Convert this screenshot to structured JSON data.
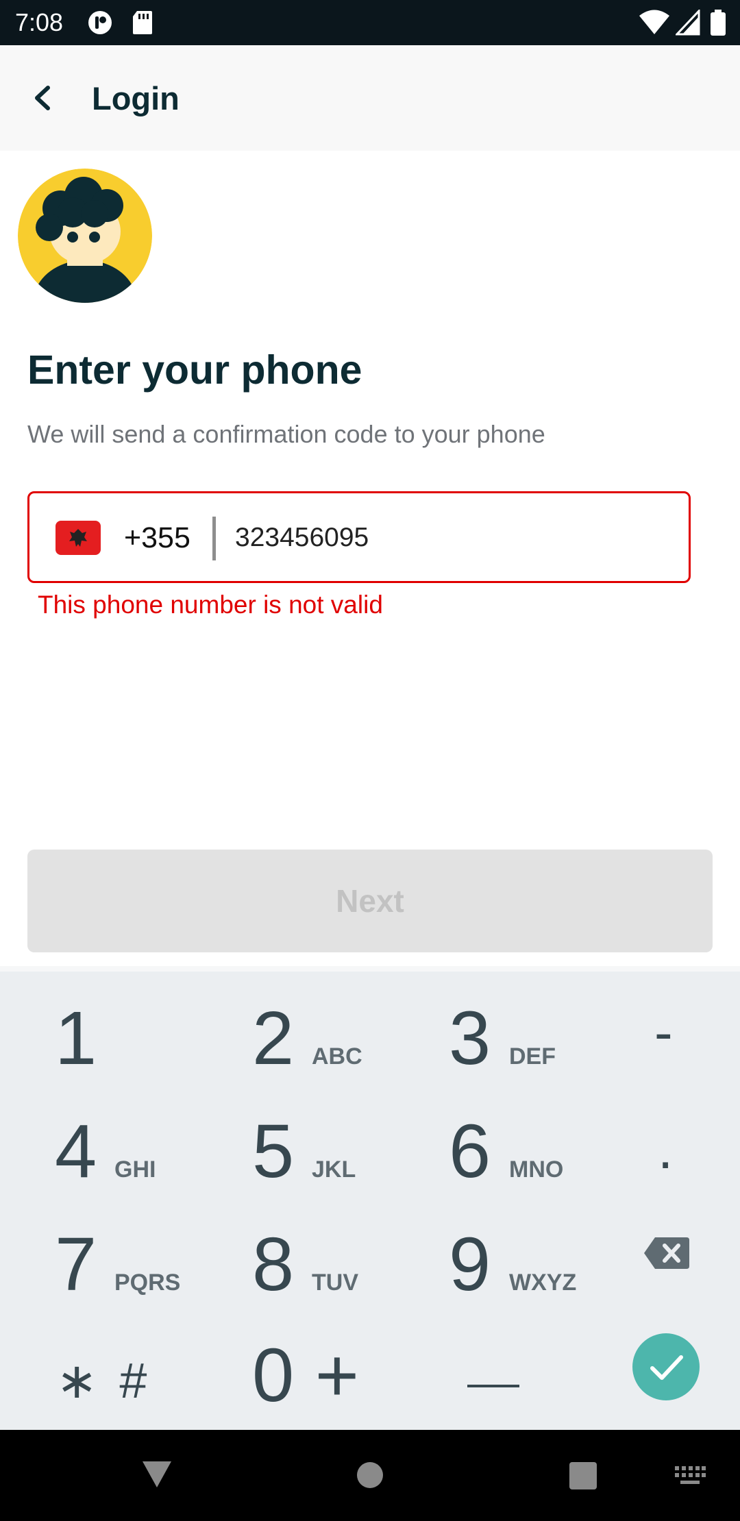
{
  "status_bar": {
    "time": "7:08",
    "left_icons": [
      "app-notification-icon",
      "sd-card-icon"
    ],
    "right_icons": [
      "wifi-icon",
      "cell-signal-icon",
      "battery-icon"
    ]
  },
  "app_bar": {
    "back_icon": "back-arrow-icon",
    "title": "Login"
  },
  "main": {
    "avatar_icon": "user-avatar-illustration",
    "heading": "Enter your phone",
    "subheading": "We will send a confirmation code to your phone",
    "phone": {
      "flag_icon": "albania-flag-icon",
      "dial_code": "+355",
      "value": "323456095",
      "error": "This phone number is not valid"
    },
    "next_button": "Next"
  },
  "keyboard": {
    "rows": [
      [
        {
          "main": "1",
          "sub": ""
        },
        {
          "main": "2",
          "sub": "ABC"
        },
        {
          "main": "3",
          "sub": "DEF"
        },
        {
          "main": "-",
          "sub": ""
        }
      ],
      [
        {
          "main": "4",
          "sub": "GHI"
        },
        {
          "main": "5",
          "sub": "JKL"
        },
        {
          "main": "6",
          "sub": "MNO"
        },
        {
          "main": ".",
          "sub": ""
        }
      ],
      [
        {
          "main": "7",
          "sub": "PQRS"
        },
        {
          "main": "8",
          "sub": "TUV"
        },
        {
          "main": "9",
          "sub": "WXYZ"
        },
        {
          "main": "",
          "sub": ""
        }
      ],
      [
        {
          "main": "∗ #",
          "sub": ""
        },
        {
          "main": "0 +",
          "sub": ""
        },
        {
          "main": "",
          "sub": ""
        },
        {
          "main": "",
          "sub": ""
        }
      ]
    ],
    "backspace_icon": "backspace-icon",
    "space_icon": "space-bar-icon",
    "done_icon": "check-icon"
  },
  "colors": {
    "title": "#0d2b33",
    "error": "#e00000",
    "done_key": "#4db6ac",
    "keyboard_bg": "#ebeef1"
  },
  "nav_bar": {
    "icons": [
      "back-triangle-icon",
      "home-circle-icon",
      "recents-square-icon",
      "keyboard-icon"
    ]
  }
}
